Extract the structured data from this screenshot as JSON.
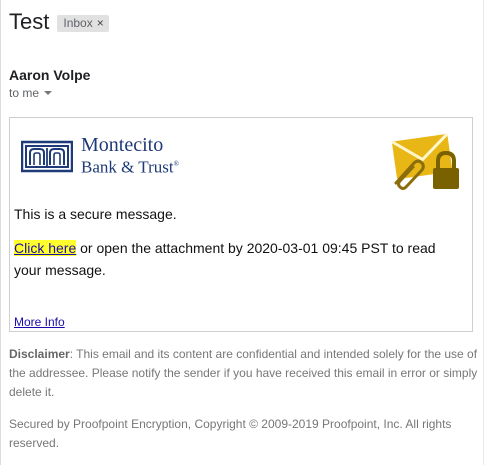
{
  "email": {
    "subject": "Test",
    "label_chip": "Inbox",
    "label_chip_close": "×",
    "sender_name": "Aaron Volpe",
    "recipient_text": "to me"
  },
  "message": {
    "logo_line1": "Montecito",
    "logo_line2": "Bank & Trust",
    "logo_mark": "®",
    "secure_text": "This is a secure message.",
    "link_text": "Click here",
    "action_text": " or open the attachment by 2020-03-01 09:45 PST to read your message.",
    "more_info": "More Info"
  },
  "footer": {
    "disclaimer_label": "Disclaimer",
    "disclaimer_text": ": This email and its content are confidential and intended solely for the use of the addressee. Please notify the sender if you have received this email in error or simply delete it.",
    "copyright": "Secured by Proofpoint Encryption, Copyright © 2009-2019 Proofpoint, Inc. All rights reserved."
  },
  "colors": {
    "brand_blue": "#1f3a78",
    "highlight": "#ffff2e",
    "link": "#1a0dab",
    "envelope_gold": "#e8b716",
    "lock_dark": "#7a6100"
  },
  "icons": [
    "bank-logo-icon",
    "secure-envelope-icon",
    "paperclip-icon",
    "padlock-icon",
    "chevron-down-icon"
  ]
}
